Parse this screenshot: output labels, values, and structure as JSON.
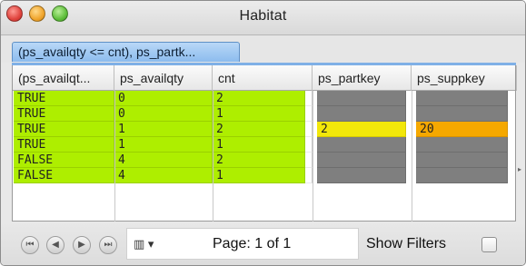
{
  "window": {
    "title": "Habitat"
  },
  "breadcrumb": {
    "label": "(ps_availqty <= cnt), ps_partk..."
  },
  "table": {
    "columns": [
      "(ps_availqt...",
      "ps_availqty",
      "cnt",
      "ps_partkey",
      "ps_suppkey"
    ],
    "rows": [
      [
        "TRUE",
        "0",
        "2",
        "",
        ""
      ],
      [
        "TRUE",
        "0",
        "1",
        "",
        ""
      ],
      [
        "TRUE",
        "1",
        "2",
        "2",
        "20"
      ],
      [
        "TRUE",
        "1",
        "1",
        "",
        ""
      ],
      [
        "FALSE",
        "4",
        "2",
        "",
        ""
      ],
      [
        "FALSE",
        "4",
        "1",
        "",
        ""
      ]
    ],
    "colors": {
      "match": "#aeee00",
      "null": "#7f7f7f",
      "partkey_highlight": "#f2e70a",
      "suppkey_highlight": "#f5a800"
    }
  },
  "footer": {
    "page_label": "Page: 1 of 1",
    "show_filters_label": "Show Filters",
    "show_filters_checked": false,
    "nav_icons": [
      "first-page-icon",
      "previous-page-icon",
      "next-page-icon",
      "last-page-icon"
    ],
    "book_icon": "book-icon"
  }
}
